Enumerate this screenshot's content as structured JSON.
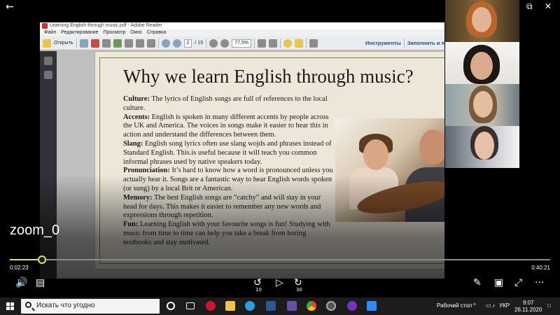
{
  "player": {
    "back_icon": "back-arrow-icon",
    "video_title": "zoom_0",
    "time_elapsed": "0:02:23",
    "time_total": "0:40:21",
    "progress": 0.06,
    "skip_back_label": "10",
    "skip_forward_label": "30",
    "accent": "#d7e85a"
  },
  "pdf": {
    "window_title": "Learning English through music.pdf - Adobe Reader",
    "menu": [
      "Файл",
      "Редактирование",
      "Просмотр",
      "Окно",
      "Справка"
    ],
    "open_label": "Открыть",
    "page_current": "2",
    "page_total": "/ 15",
    "zoom": "77,5%",
    "tools_label": "Инструменты",
    "fill_sign_label": "Заполнить и п"
  },
  "slide": {
    "title": "Why we learn English through music?",
    "items": [
      {
        "term": "Culture:",
        "text": " The lyrics of English songs are full of references to the local culture."
      },
      {
        "term": "Accents:",
        "text": " English is spoken in many different accents by people across the UK and America. The voices in songs make it easier to hear this in action and understand the differences between them."
      },
      {
        "term": "Slang:",
        "text": " English song lyrics often use slang wojds and phrases instead of Standard English. This.is useful because it will teach you common informal phrases used by native speakers today."
      },
      {
        "term": "Pronunciation:",
        "text": " It’s hard to know how a word is pronounced unless you actually hear it. Songs are a fantastic way to hear English words spoken (or sung) by a local Brit or American."
      },
      {
        "term": "Memory:",
        "text": " The best English songs are “catchy” and will stay in your head for days. This makes it easier to remember any new words and expressions through repetition."
      },
      {
        "term": "Fun:",
        "text": " Learning English with your favourite songs is fun! Studying with music from time to time can help you take a break from boring textbooks and stay motivated."
      }
    ]
  },
  "taskbar": {
    "search_placeholder": "Искать что угодно",
    "desktop_label": "Рабочий стол",
    "language": "УКР",
    "time": "9:07",
    "date": "26.11.2020"
  }
}
